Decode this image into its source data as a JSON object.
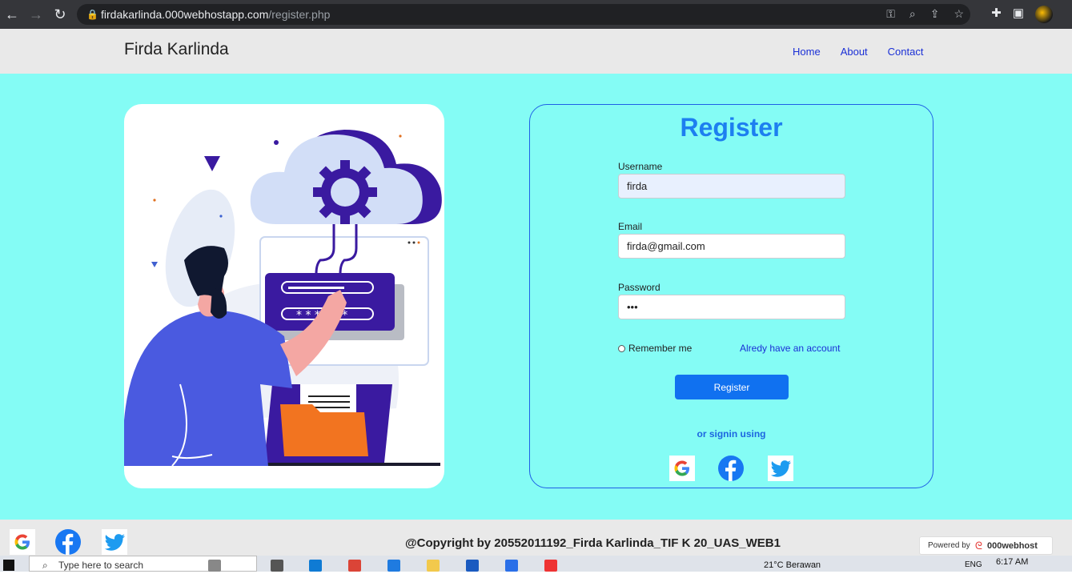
{
  "browser": {
    "url_host": "firdakarlinda.000webhostapp.com",
    "url_path": "/register.php"
  },
  "header": {
    "brand": "Firda Karlinda",
    "nav": [
      "Home",
      "About",
      "Contact"
    ]
  },
  "form": {
    "title": "Register",
    "username_label": "Username",
    "username_value": "firda",
    "email_label": "Email",
    "email_value": "firda@gmail.com",
    "password_label": "Password",
    "password_value": "•••",
    "remember_label": "Remember me",
    "have_account_link": "Alredy have an account",
    "register_button": "Register",
    "or_signin": "or signin using"
  },
  "footer": {
    "copyright": "@Copyright by 20552011192_Firda Karlinda_TIF K 20_UAS_WEB1",
    "powered_label": "Powered by",
    "powered_brand": "000webhost"
  },
  "taskbar": {
    "search_placeholder": "Type here to search",
    "weather": "21°C  Berawan",
    "lang": "ENG",
    "time": "6:17 AM"
  },
  "colors": {
    "main_bg": "#84fcf5",
    "accent": "#1071f0",
    "title": "#1d7ff0"
  }
}
